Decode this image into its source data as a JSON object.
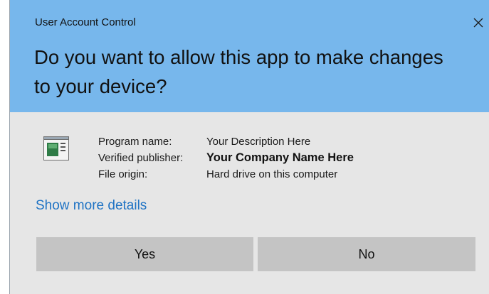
{
  "window": {
    "title": "User Account Control",
    "close_glyph": "✕"
  },
  "header": {
    "question": "Do you want to allow this app to make changes to your device?"
  },
  "app": {
    "icon": "application-window-icon",
    "fields": [
      {
        "label": "Program name:",
        "value": "Your Description Here"
      },
      {
        "label": "Verified publisher:",
        "value": "Your Company Name Here"
      },
      {
        "label": "File origin:",
        "value": "Hard drive on this computer"
      }
    ]
  },
  "details_link": "Show more details",
  "buttons": {
    "yes": "Yes",
    "no": "No"
  },
  "colors": {
    "header_bg": "#77b7ec",
    "body_bg": "#e6e6e6",
    "button_bg": "#c4c4c4",
    "link": "#1f73c4"
  }
}
